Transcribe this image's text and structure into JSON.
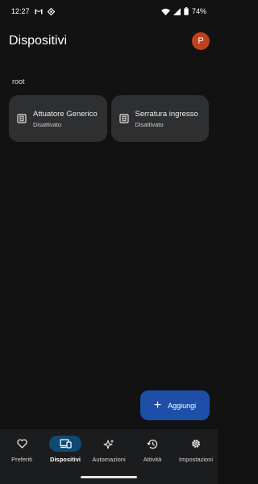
{
  "status_bar": {
    "time": "12:27",
    "battery": "74%",
    "icons_left": [
      "gmail-icon",
      "app-icon"
    ],
    "icons_right": [
      "wifi-icon",
      "signal-icon",
      "battery-icon"
    ]
  },
  "header": {
    "title": "Dispositivi",
    "avatar_letter": "P"
  },
  "section": {
    "label": "root"
  },
  "devices": [
    {
      "name": "Attuatore Generico",
      "status": "Disattivato"
    },
    {
      "name": "Serratura ingresso",
      "status": "Disattivato"
    }
  ],
  "fab": {
    "label": "Aggiungi"
  },
  "nav": {
    "items": [
      {
        "label": "Preferiti",
        "icon": "heart-icon"
      },
      {
        "label": "Dispositivi",
        "icon": "devices-icon",
        "active": true
      },
      {
        "label": "Automazioni",
        "icon": "sparkle-icon"
      },
      {
        "label": "Attività",
        "icon": "history-icon"
      },
      {
        "label": "Impostazioni",
        "icon": "gear-icon"
      }
    ]
  },
  "colors": {
    "background": "#121212",
    "card": "#2d2f31",
    "accent": "#1d4fa8",
    "active_nav": "#0e4a73",
    "avatar": "#c0411b"
  }
}
